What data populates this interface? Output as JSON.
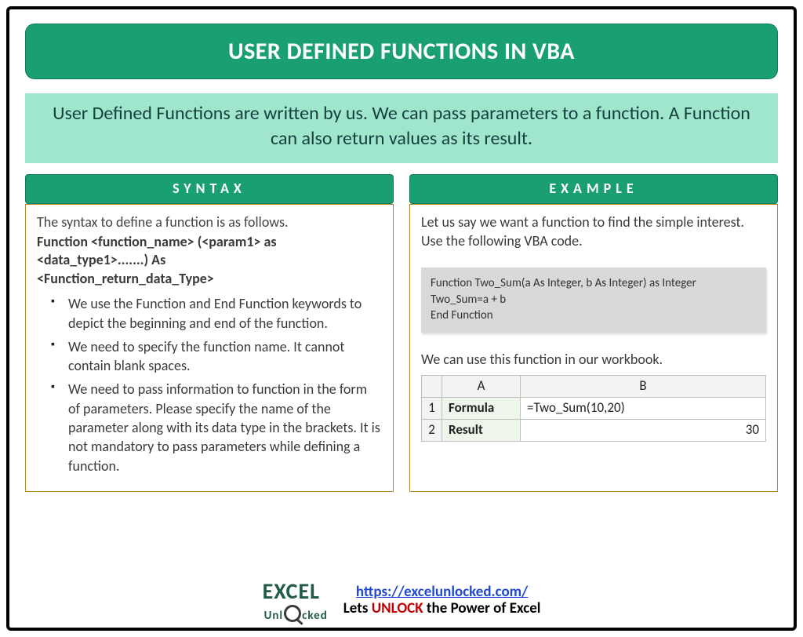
{
  "title": "USER DEFINED FUNCTIONS IN VBA",
  "intro": "User Defined Functions are written by us. We can pass parameters to a function. A Function can also return values as its result.",
  "syntax": {
    "header": "SYNTAX",
    "lead": "The syntax to define a function is as follows.",
    "code_line1": "Function <function_name> (<param1> as",
    "code_line2": "<data_type1>.......) As",
    "code_line3": "<Function_return_data_Type>",
    "bullets": [
      "We use the Function and End Function keywords to depict the beginning and end of the function.",
      "We need to specify the function name. It cannot contain blank spaces.",
      "We need to pass information to function in the form of parameters. Please specify the name of the parameter along with its data type in the brackets. It is not mandatory to pass parameters while defining a function."
    ]
  },
  "example": {
    "header": "EXAMPLE",
    "intro": "Let us say we want a function to find the simple interest. Use the following VBA code.",
    "code": {
      "l1": "Function Two_Sum(a As Integer, b As Integer) as Integer",
      "l2": "Two_Sum=a + b",
      "l3": "End Function"
    },
    "after": "We can use this function in our workbook.",
    "sheet": {
      "colA": "A",
      "colB": "B",
      "r1": "1",
      "r2": "2",
      "a1": "Formula",
      "b1": "=Two_Sum(10,20)",
      "a2": "Result",
      "b2": "30"
    }
  },
  "footer": {
    "logo_top": "EXCEL",
    "logo_sub": "Unl   cked",
    "url_text": "https://excelunlocked.com/",
    "url_href": "https://excelunlocked.com/",
    "tag_pre": "Lets ",
    "tag_unlock": "UNLOCK",
    "tag_post": " the Power of Excel"
  }
}
